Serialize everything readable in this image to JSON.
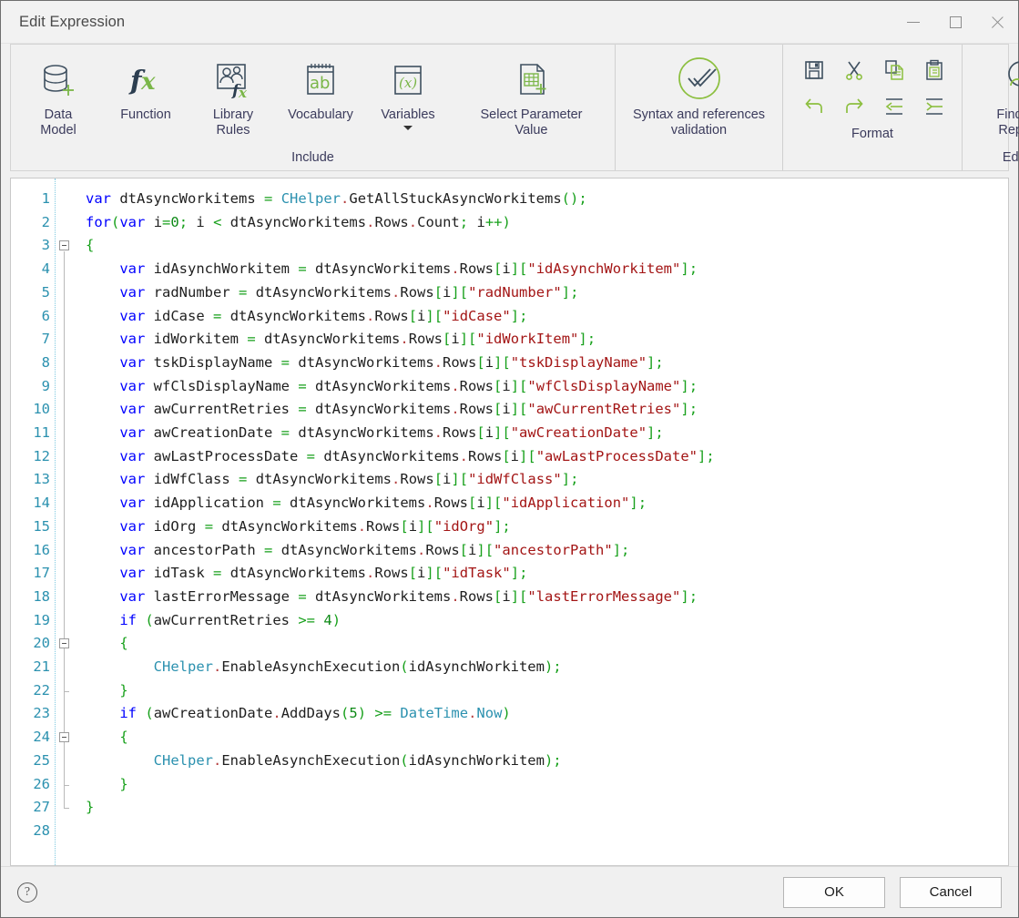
{
  "window": {
    "title": "Edit Expression",
    "controls": {
      "minimize": "minimize-button",
      "maximize": "maximize-button",
      "close": "close-button"
    }
  },
  "ribbon": {
    "groups": [
      {
        "label": "Include",
        "buttons": [
          {
            "icon": "database-add-icon",
            "label": "Data\nModel"
          },
          {
            "icon": "function-fx-icon",
            "label": "Function"
          },
          {
            "icon": "library-rules-icon",
            "label": "Library\nRules"
          },
          {
            "icon": "vocabulary-ab-icon",
            "label": "Vocabulary"
          },
          {
            "icon": "variables-x-icon",
            "label": "Variables",
            "has_caret": true
          },
          {
            "icon": "select-parameter-value-icon",
            "label": "Select Parameter\nValue"
          }
        ]
      },
      {
        "label": "",
        "buttons": [
          {
            "icon": "syntax-validation-check-icon",
            "label": "Syntax and references\nvalidation"
          }
        ]
      },
      {
        "label": "Format",
        "icons": [
          "save-icon",
          "cut-icon",
          "copy-icon",
          "paste-icon",
          "undo-icon",
          "redo-icon",
          "outdent-icon",
          "indent-icon"
        ]
      },
      {
        "label": "Editing",
        "buttons": [
          {
            "icon": "find-and-replace-icon",
            "label": "Find And\nReplace"
          }
        ]
      }
    ]
  },
  "editor": {
    "line_numbers": [
      1,
      2,
      3,
      4,
      5,
      6,
      7,
      8,
      9,
      10,
      11,
      12,
      13,
      14,
      15,
      16,
      17,
      18,
      19,
      20,
      21,
      22,
      23,
      24,
      25,
      26,
      27,
      28
    ],
    "total_lines": 28,
    "colors": {
      "keyword": "#0000ff",
      "type": "#2b91af",
      "string": "#a31515",
      "bracket": "#17a01b",
      "identifier": "#1f1f1f",
      "line_number": "#2b91af"
    },
    "fold_markers": [
      3,
      20,
      24
    ],
    "lines": [
      "var dtAsyncWorkitems = CHelper.GetAllStuckAsyncWorkitems();",
      "for(var i=0; i < dtAsyncWorkitems.Rows.Count; i++)",
      "{",
      "    var idAsynchWorkitem = dtAsyncWorkitems.Rows[i][\"idAsynchWorkitem\"];",
      "    var radNumber = dtAsyncWorkitems.Rows[i][\"radNumber\"];",
      "    var idCase = dtAsyncWorkitems.Rows[i][\"idCase\"];",
      "    var idWorkitem = dtAsyncWorkitems.Rows[i][\"idWorkItem\"];",
      "    var tskDisplayName = dtAsyncWorkitems.Rows[i][\"tskDisplayName\"];",
      "    var wfClsDisplayName = dtAsyncWorkitems.Rows[i][\"wfClsDisplayName\"];",
      "    var awCurrentRetries = dtAsyncWorkitems.Rows[i][\"awCurrentRetries\"];",
      "    var awCreationDate = dtAsyncWorkitems.Rows[i][\"awCreationDate\"];",
      "    var awLastProcessDate = dtAsyncWorkitems.Rows[i][\"awLastProcessDate\"];",
      "    var idWfClass = dtAsyncWorkitems.Rows[i][\"idWfClass\"];",
      "    var idApplication = dtAsyncWorkitems.Rows[i][\"idApplication\"];",
      "    var idOrg = dtAsyncWorkitems.Rows[i][\"idOrg\"];",
      "    var ancestorPath = dtAsyncWorkitems.Rows[i][\"ancestorPath\"];",
      "    var idTask = dtAsyncWorkitems.Rows[i][\"idTask\"];",
      "    var lastErrorMessage = dtAsyncWorkitems.Rows[i][\"lastErrorMessage\"];",
      "    if (awCurrentRetries >= 4)",
      "    {",
      "        CHelper.EnableAsynchExecution(idAsynchWorkitem);",
      "    }",
      "    if (awCreationDate.AddDays(5) >= DateTime.Now)",
      "    {",
      "        CHelper.EnableAsynchExecution(idAsynchWorkitem);",
      "    }",
      "}",
      ""
    ]
  },
  "footer": {
    "help_glyph": "?",
    "ok_label": "OK",
    "cancel_label": "Cancel"
  }
}
